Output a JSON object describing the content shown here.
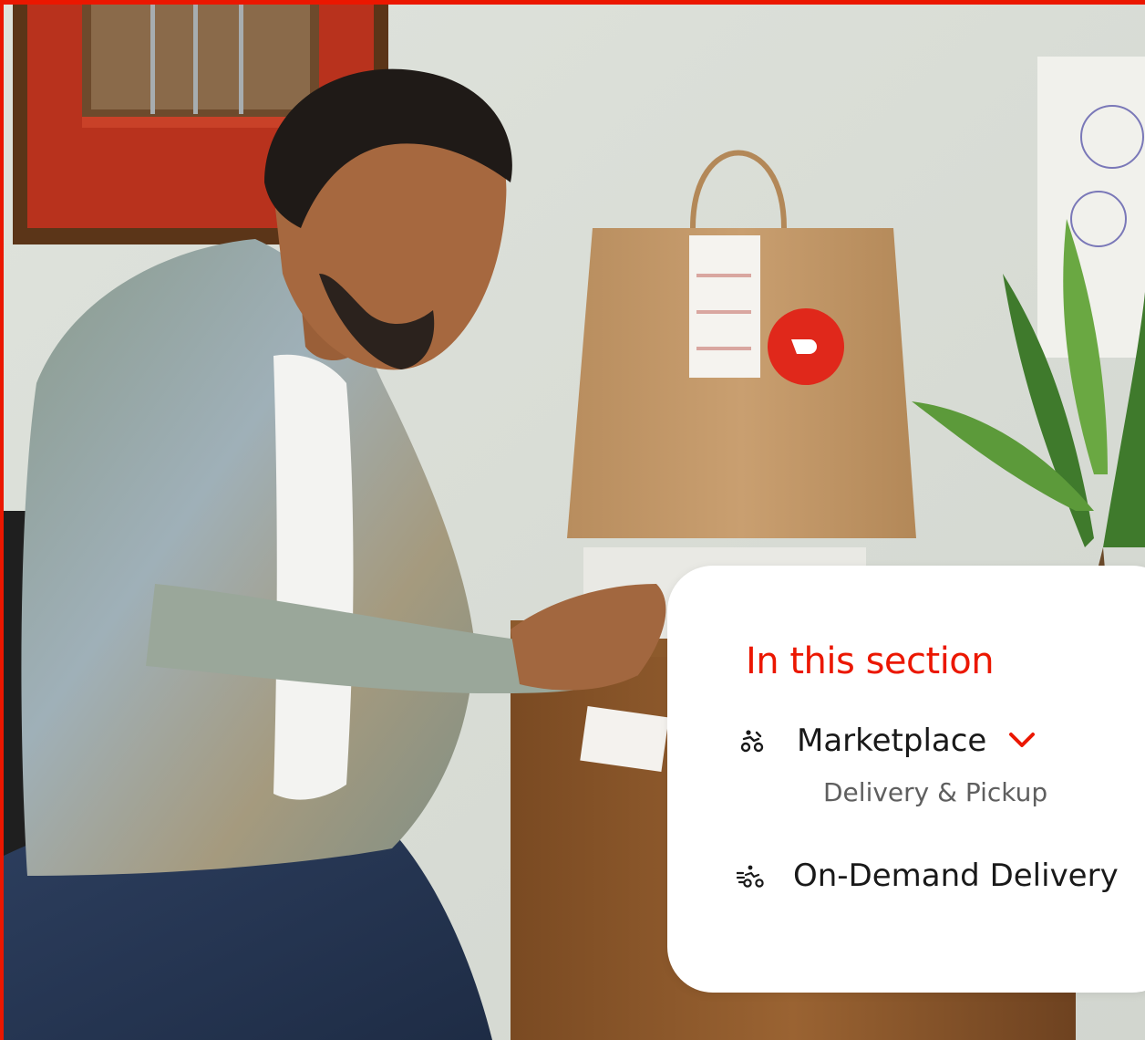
{
  "photo": {
    "description_icon": "doordash-courier-photo",
    "accent_color": "#eb1700"
  },
  "section": {
    "title": "In this section",
    "items": [
      {
        "label": "Marketplace",
        "icon": "scooter-people-icon",
        "expanded": true,
        "subitems": [
          {
            "label": "Delivery & Pickup"
          }
        ]
      },
      {
        "label": "On-Demand Delivery",
        "icon": "fast-scooter-icon"
      }
    ]
  }
}
